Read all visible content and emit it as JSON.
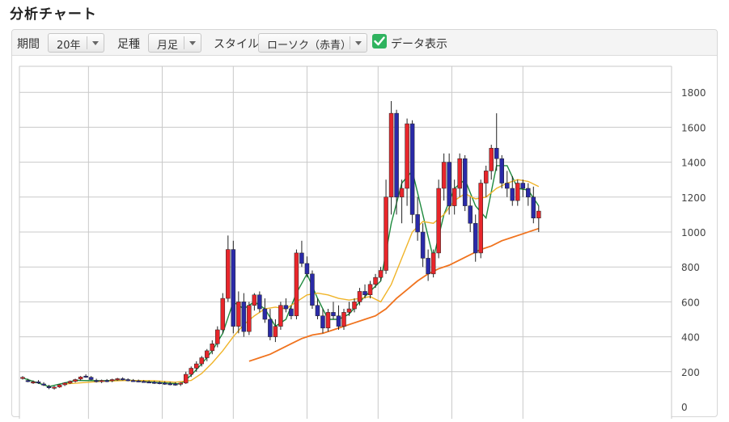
{
  "page": {
    "title": "分析チャート"
  },
  "toolbar": {
    "period_label": "期間",
    "period_value": "20年",
    "foot_label": "足種",
    "foot_value": "月足",
    "style_label": "スタイル",
    "style_value": "ローソク（赤青）",
    "data_display_label": "データ表示",
    "data_display_checked": true
  },
  "colors": {
    "up": "#e8262b",
    "down": "#2a2aa8",
    "ma_short": "#1e8a3e",
    "ma_mid": "#f0b429",
    "ma_long": "#f0731e",
    "grid": "#c9c9c9",
    "check": "#2fb35f"
  },
  "chart_data": {
    "type": "candlestick",
    "xlabel": "",
    "ylabel": "",
    "ylim": [
      0,
      1900
    ],
    "yticks": [
      0,
      200,
      400,
      600,
      800,
      1000,
      1200,
      1400,
      1600,
      1800
    ],
    "grid": true,
    "x_range": [
      0,
      244
    ],
    "x_gridlines": [
      25,
      53,
      80,
      108,
      135,
      163,
      190
    ],
    "candles": [
      [
        0,
        165,
        175,
        155,
        168
      ],
      [
        2,
        150,
        160,
        140,
        145
      ],
      [
        4,
        140,
        150,
        130,
        142
      ],
      [
        6,
        142,
        152,
        130,
        138
      ],
      [
        8,
        130,
        140,
        118,
        125
      ],
      [
        10,
        115,
        125,
        100,
        108
      ],
      [
        12,
        108,
        118,
        98,
        112
      ],
      [
        14,
        112,
        128,
        108,
        125
      ],
      [
        16,
        125,
        140,
        118,
        135
      ],
      [
        18,
        135,
        150,
        130,
        145
      ],
      [
        20,
        145,
        160,
        138,
        155
      ],
      [
        22,
        158,
        175,
        150,
        170
      ],
      [
        24,
        175,
        185,
        165,
        170
      ],
      [
        26,
        168,
        175,
        150,
        155
      ],
      [
        28,
        150,
        160,
        138,
        145
      ],
      [
        30,
        145,
        155,
        135,
        150
      ],
      [
        32,
        150,
        158,
        140,
        148
      ],
      [
        34,
        148,
        160,
        140,
        155
      ],
      [
        36,
        155,
        165,
        148,
        160
      ],
      [
        38,
        160,
        168,
        150,
        155
      ],
      [
        40,
        155,
        162,
        145,
        150
      ],
      [
        42,
        150,
        158,
        142,
        148
      ],
      [
        44,
        148,
        155,
        140,
        145
      ],
      [
        46,
        145,
        152,
        138,
        142
      ],
      [
        48,
        142,
        150,
        135,
        140
      ],
      [
        50,
        140,
        148,
        130,
        138
      ],
      [
        52,
        138,
        146,
        128,
        135
      ],
      [
        54,
        135,
        145,
        125,
        132
      ],
      [
        56,
        132,
        142,
        122,
        130
      ],
      [
        58,
        130,
        140,
        120,
        128
      ],
      [
        60,
        128,
        140,
        118,
        135
      ],
      [
        62,
        135,
        200,
        130,
        185
      ],
      [
        64,
        185,
        230,
        170,
        220
      ],
      [
        66,
        220,
        260,
        200,
        245
      ],
      [
        68,
        245,
        290,
        230,
        280
      ],
      [
        70,
        280,
        330,
        260,
        320
      ],
      [
        72,
        320,
        380,
        300,
        360
      ],
      [
        74,
        360,
        460,
        340,
        440
      ],
      [
        76,
        440,
        650,
        420,
        620
      ],
      [
        78,
        620,
        980,
        600,
        900
      ],
      [
        80,
        900,
        950,
        420,
        460
      ],
      [
        82,
        460,
        660,
        420,
        600
      ],
      [
        84,
        600,
        650,
        400,
        430
      ],
      [
        86,
        430,
        600,
        410,
        580
      ],
      [
        88,
        580,
        650,
        550,
        640
      ],
      [
        90,
        640,
        660,
        540,
        560
      ],
      [
        92,
        560,
        620,
        480,
        500
      ],
      [
        94,
        500,
        560,
        380,
        400
      ],
      [
        96,
        400,
        500,
        370,
        460
      ],
      [
        98,
        460,
        600,
        440,
        580
      ],
      [
        100,
        580,
        620,
        540,
        560
      ],
      [
        102,
        560,
        580,
        500,
        520
      ],
      [
        104,
        520,
        900,
        500,
        880
      ],
      [
        106,
        880,
        950,
        800,
        820
      ],
      [
        108,
        820,
        860,
        740,
        760
      ],
      [
        110,
        760,
        780,
        560,
        580
      ],
      [
        112,
        580,
        620,
        500,
        520
      ],
      [
        114,
        520,
        560,
        420,
        450
      ],
      [
        116,
        450,
        560,
        430,
        540
      ],
      [
        118,
        540,
        600,
        500,
        520
      ],
      [
        120,
        520,
        580,
        440,
        460
      ],
      [
        122,
        460,
        560,
        440,
        540
      ],
      [
        124,
        540,
        600,
        520,
        560
      ],
      [
        126,
        560,
        620,
        540,
        600
      ],
      [
        128,
        600,
        680,
        580,
        660
      ],
      [
        130,
        660,
        700,
        620,
        640
      ],
      [
        132,
        640,
        720,
        620,
        700
      ],
      [
        134,
        700,
        760,
        680,
        740
      ],
      [
        136,
        740,
        800,
        720,
        780
      ],
      [
        138,
        780,
        1300,
        760,
        1200
      ],
      [
        140,
        1200,
        1750,
        1100,
        1680
      ],
      [
        142,
        1680,
        1700,
        1100,
        1200
      ],
      [
        144,
        1200,
        1300,
        1050,
        1250
      ],
      [
        146,
        1250,
        1650,
        1150,
        1620
      ],
      [
        148,
        1620,
        1640,
        1050,
        1100
      ],
      [
        150,
        1100,
        1200,
        950,
        1000
      ],
      [
        152,
        1000,
        1050,
        800,
        850
      ],
      [
        154,
        850,
        900,
        720,
        760
      ],
      [
        156,
        760,
        900,
        740,
        880
      ],
      [
        158,
        880,
        1300,
        850,
        1250
      ],
      [
        160,
        1250,
        1450,
        1180,
        1400
      ],
      [
        162,
        1400,
        1450,
        1100,
        1150
      ],
      [
        164,
        1150,
        1300,
        1100,
        1250
      ],
      [
        166,
        1250,
        1450,
        1200,
        1420
      ],
      [
        168,
        1420,
        1440,
        1120,
        1150
      ],
      [
        170,
        1150,
        1200,
        1000,
        1050
      ],
      [
        172,
        1050,
        1100,
        830,
        880
      ],
      [
        174,
        880,
        1300,
        850,
        1280
      ],
      [
        176,
        1280,
        1380,
        1200,
        1350
      ],
      [
        178,
        1350,
        1500,
        1300,
        1480
      ],
      [
        180,
        1480,
        1680,
        1350,
        1420
      ],
      [
        182,
        1420,
        1440,
        1250,
        1280
      ],
      [
        184,
        1280,
        1350,
        1200,
        1250
      ],
      [
        186,
        1250,
        1320,
        1150,
        1180
      ],
      [
        188,
        1180,
        1300,
        1150,
        1280
      ],
      [
        190,
        1280,
        1300,
        1200,
        1250
      ],
      [
        192,
        1250,
        1280,
        1150,
        1200
      ],
      [
        194,
        1200,
        1260,
        1050,
        1080
      ],
      [
        196,
        1080,
        1150,
        1000,
        1120
      ]
    ],
    "series": [
      {
        "key": "ma_short",
        "points": [
          [
            0,
            165
          ],
          [
            10,
            115
          ],
          [
            20,
            150
          ],
          [
            30,
            148
          ],
          [
            40,
            152
          ],
          [
            50,
            140
          ],
          [
            60,
            130
          ],
          [
            64,
            180
          ],
          [
            68,
            245
          ],
          [
            72,
            320
          ],
          [
            76,
            420
          ],
          [
            80,
            600
          ],
          [
            84,
            560
          ],
          [
            88,
            600
          ],
          [
            92,
            560
          ],
          [
            96,
            460
          ],
          [
            100,
            500
          ],
          [
            104,
            650
          ],
          [
            108,
            760
          ],
          [
            112,
            620
          ],
          [
            116,
            500
          ],
          [
            120,
            500
          ],
          [
            124,
            530
          ],
          [
            128,
            600
          ],
          [
            132,
            660
          ],
          [
            136,
            720
          ],
          [
            140,
            1050
          ],
          [
            144,
            1280
          ],
          [
            148,
            1350
          ],
          [
            152,
            1100
          ],
          [
            156,
            850
          ],
          [
            160,
            1100
          ],
          [
            164,
            1250
          ],
          [
            168,
            1300
          ],
          [
            172,
            1150
          ],
          [
            176,
            1080
          ],
          [
            180,
            1380
          ],
          [
            184,
            1380
          ],
          [
            188,
            1250
          ],
          [
            192,
            1240
          ],
          [
            196,
            1150
          ]
        ]
      },
      {
        "key": "ma_mid",
        "points": [
          [
            16,
            130
          ],
          [
            30,
            145
          ],
          [
            40,
            150
          ],
          [
            50,
            148
          ],
          [
            58,
            140
          ],
          [
            64,
            150
          ],
          [
            68,
            190
          ],
          [
            72,
            250
          ],
          [
            76,
            320
          ],
          [
            80,
            400
          ],
          [
            84,
            470
          ],
          [
            88,
            520
          ],
          [
            92,
            560
          ],
          [
            96,
            570
          ],
          [
            100,
            560
          ],
          [
            104,
            600
          ],
          [
            108,
            640
          ],
          [
            112,
            650
          ],
          [
            116,
            640
          ],
          [
            120,
            620
          ],
          [
            124,
            610
          ],
          [
            128,
            620
          ],
          [
            132,
            630
          ],
          [
            136,
            600
          ],
          [
            140,
            700
          ],
          [
            144,
            850
          ],
          [
            148,
            1000
          ],
          [
            152,
            1060
          ],
          [
            156,
            1050
          ],
          [
            160,
            1100
          ],
          [
            164,
            1180
          ],
          [
            168,
            1220
          ],
          [
            172,
            1190
          ],
          [
            176,
            1200
          ],
          [
            180,
            1250
          ],
          [
            184,
            1280
          ],
          [
            188,
            1300
          ],
          [
            192,
            1290
          ],
          [
            196,
            1260
          ]
        ]
      },
      {
        "key": "ma_long",
        "points": [
          [
            86,
            260
          ],
          [
            90,
            280
          ],
          [
            94,
            300
          ],
          [
            98,
            330
          ],
          [
            102,
            360
          ],
          [
            106,
            390
          ],
          [
            110,
            410
          ],
          [
            114,
            420
          ],
          [
            118,
            440
          ],
          [
            122,
            460
          ],
          [
            126,
            480
          ],
          [
            130,
            500
          ],
          [
            134,
            520
          ],
          [
            138,
            560
          ],
          [
            142,
            620
          ],
          [
            146,
            670
          ],
          [
            150,
            720
          ],
          [
            154,
            760
          ],
          [
            158,
            790
          ],
          [
            162,
            810
          ],
          [
            166,
            840
          ],
          [
            170,
            870
          ],
          [
            174,
            900
          ],
          [
            178,
            920
          ],
          [
            182,
            950
          ],
          [
            186,
            970
          ],
          [
            190,
            990
          ],
          [
            194,
            1010
          ],
          [
            196,
            1020
          ]
        ]
      }
    ]
  }
}
